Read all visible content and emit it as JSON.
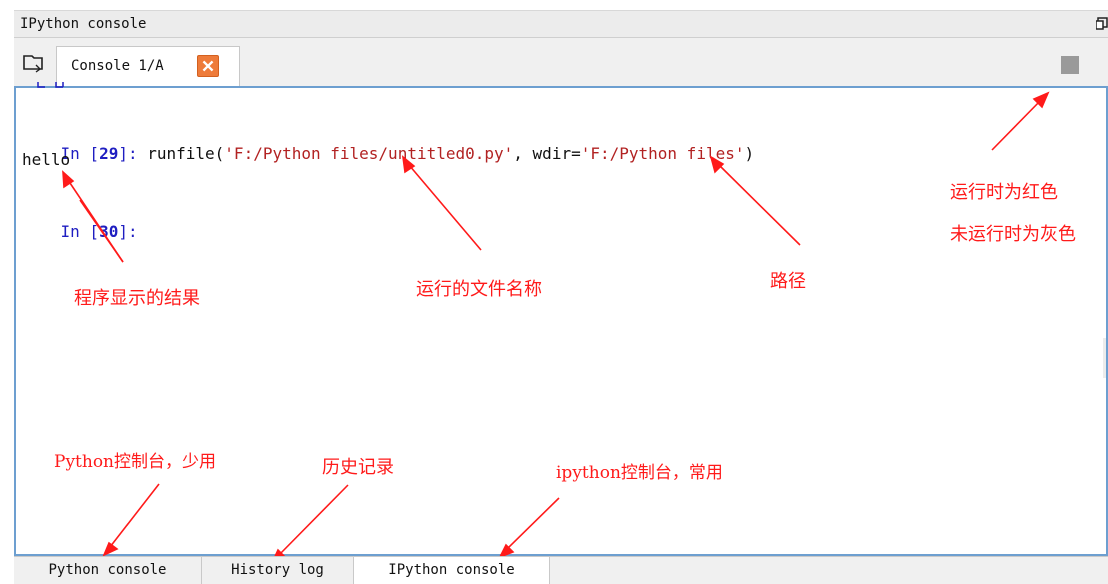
{
  "pane": {
    "title": "IPython console"
  },
  "tabs": {
    "console_tab_label": "Console 1/A"
  },
  "console": {
    "line1_prompt_pre": "In [",
    "line1_prompt_num": "29",
    "line1_prompt_post": "]: ",
    "line1_call": "runfile(",
    "line1_arg1": "'F:/Python files/untitled0.py'",
    "line1_sep": ", wdir=",
    "line1_arg2": "'F:/Python files'",
    "line1_close": ")",
    "output": "hello",
    "line2_prompt_pre": "In [",
    "line2_prompt_num": "30",
    "line2_prompt_post": "]:"
  },
  "annotations": {
    "running_red": "运行时为红色",
    "idle_gray": "未运行时为灰色",
    "program_result": "程序显示的结果",
    "file_name": "运行的文件名称",
    "path": "路径",
    "python_console": "Python控制台，少用",
    "history": "历史记录",
    "ipython_console": "ipython控制台，常用"
  },
  "bottom_tabs": [
    {
      "label": "Python console"
    },
    {
      "label": "History log"
    },
    {
      "label": "IPython console"
    }
  ],
  "colors": {
    "annotation": "#ff1a1a",
    "prompt": "#1f1ec1",
    "string": "#b22222",
    "console_border": "#6d9fd0",
    "stop_idle": "#9a9a9a",
    "close_tab": "#ee7b3a"
  },
  "icons": [
    "undock-icon",
    "browse-tabs-icon",
    "close-tab-icon",
    "stop-icon"
  ]
}
